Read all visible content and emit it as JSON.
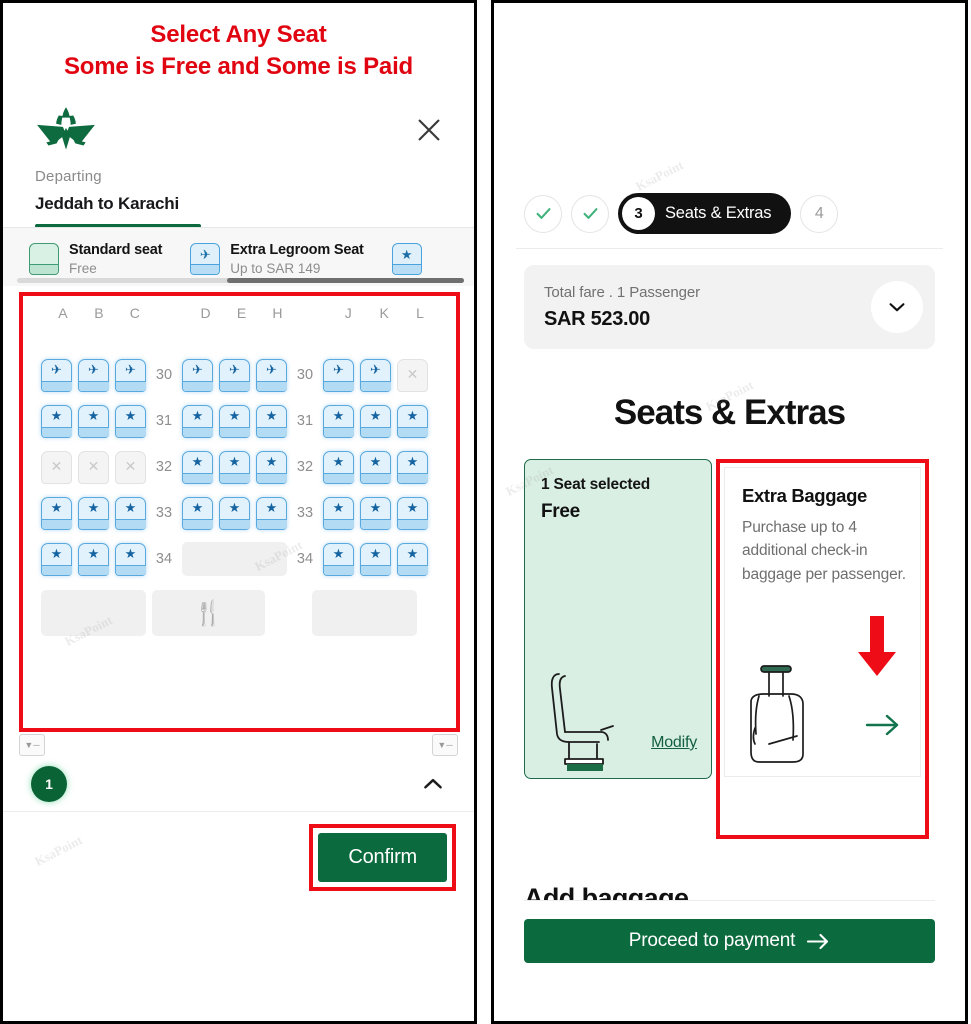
{
  "annotation": {
    "line1": "Select Any Seat",
    "line2": "Some is Free and Some is Paid",
    "color": "#e00510"
  },
  "theme": {
    "brand_green": "#0c6b3e",
    "highlight_red": "#ee0d17",
    "seat_blue": "#5aa9de",
    "selected_green_bg": "#daefe4"
  },
  "left_panel": {
    "logo_name": "saudia-logo",
    "close_icon": "close-icon",
    "route_label": "Departing",
    "route_title": "Jeddah to Karachi",
    "legend": [
      {
        "name": "Standard seat",
        "sub": "Free",
        "type": "standard",
        "glyph": ""
      },
      {
        "name": "Extra Legroom Seat",
        "sub": "Up to SAR 149",
        "type": "legroom",
        "glyph": "✈"
      },
      {
        "name": "",
        "sub": "",
        "type": "legroom",
        "glyph": "★"
      }
    ],
    "seatmap": {
      "columns": [
        "A",
        "B",
        "C",
        "D",
        "E",
        "H",
        "J",
        "K",
        "L"
      ],
      "rows": [
        {
          "number": "30",
          "left": [
            {
              "state": "legroom",
              "mark": "✈"
            },
            {
              "state": "legroom",
              "mark": "✈"
            },
            {
              "state": "legroom",
              "mark": "✈"
            }
          ],
          "middle": [
            {
              "state": "legroom",
              "mark": "✈"
            },
            {
              "state": "legroom",
              "mark": "✈"
            },
            {
              "state": "legroom",
              "mark": "✈"
            }
          ],
          "right": [
            {
              "state": "legroom",
              "mark": "✈"
            },
            {
              "state": "legroom",
              "mark": "✈"
            },
            {
              "state": "blocked",
              "mark": "✕"
            }
          ]
        },
        {
          "number": "31",
          "left": [
            {
              "state": "available",
              "mark": "★"
            },
            {
              "state": "available",
              "mark": "★"
            },
            {
              "state": "available",
              "mark": "★"
            }
          ],
          "middle": [
            {
              "state": "available",
              "mark": "★"
            },
            {
              "state": "available",
              "mark": "★"
            },
            {
              "state": "available",
              "mark": "★"
            }
          ],
          "right": [
            {
              "state": "available",
              "mark": "★"
            },
            {
              "state": "available",
              "mark": "★"
            },
            {
              "state": "available",
              "mark": "★"
            }
          ]
        },
        {
          "number": "32",
          "left": [
            {
              "state": "blocked",
              "mark": "✕"
            },
            {
              "state": "blocked",
              "mark": "✕"
            },
            {
              "state": "blocked",
              "mark": "✕"
            }
          ],
          "middle": [
            {
              "state": "available",
              "mark": "★"
            },
            {
              "state": "available",
              "mark": "★"
            },
            {
              "state": "available",
              "mark": "★"
            }
          ],
          "right": [
            {
              "state": "available",
              "mark": "★"
            },
            {
              "state": "available",
              "mark": "★"
            },
            {
              "state": "available",
              "mark": "★"
            }
          ]
        },
        {
          "number": "33",
          "left": [
            {
              "state": "available",
              "mark": "★"
            },
            {
              "state": "available",
              "mark": "★"
            },
            {
              "state": "available",
              "mark": "★"
            }
          ],
          "middle": [
            {
              "state": "available",
              "mark": "★"
            },
            {
              "state": "available",
              "mark": "★"
            },
            {
              "state": "available",
              "mark": "★"
            }
          ],
          "right": [
            {
              "state": "available",
              "mark": "★"
            },
            {
              "state": "available",
              "mark": "★"
            },
            {
              "state": "available",
              "mark": "★"
            }
          ]
        },
        {
          "number": "34",
          "left": [
            {
              "state": "available",
              "mark": "★"
            },
            {
              "state": "available",
              "mark": "★"
            },
            {
              "state": "available",
              "mark": "★"
            }
          ],
          "middle": [
            {
              "state": "blank",
              "mark": ""
            }
          ],
          "right": [
            {
              "state": "available",
              "mark": "★"
            },
            {
              "state": "available",
              "mark": "★"
            },
            {
              "state": "available",
              "mark": "★"
            }
          ]
        }
      ],
      "galley_icon": "🍴",
      "exit_tag_icon": "exit-row-icon"
    },
    "passenger_badge": "1",
    "collapse_icon": "chevron-up-icon",
    "confirm_label": "Confirm"
  },
  "right_panel": {
    "stepper": {
      "completed_icon": "check-icon",
      "active_number": "3",
      "active_label": "Seats & Extras",
      "next_number": "4"
    },
    "fare": {
      "label": "Total fare . 1 Passenger",
      "amount": "SAR 523.00",
      "toggle_icon": "chevron-down-icon"
    },
    "title": "Seats & Extras",
    "seat_card": {
      "line1": "1 Seat selected",
      "line2": "Free",
      "link": "Modify",
      "illustration": "airplane-seat-illustration"
    },
    "baggage_card": {
      "title": "Extra Baggage",
      "description": "Purchase up to 4 additional check-in baggage per passenger.",
      "illustration": "suitcase-illustration",
      "cta_icon": "arrow-right-icon",
      "pointer_icon": "red-down-arrow-icon"
    },
    "next_section_title": "Add baggage",
    "pay_label": "Proceed to payment",
    "pay_icon": "arrow-right-icon"
  },
  "watermark": "KsaPoint"
}
